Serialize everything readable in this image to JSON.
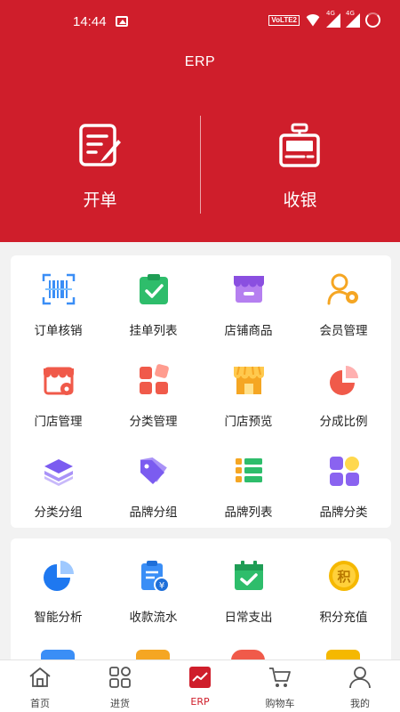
{
  "status": {
    "time": "14:44",
    "volte": "VoLTE2",
    "net1": "4G",
    "net2": "4G"
  },
  "header": {
    "title": "ERP"
  },
  "actions": [
    {
      "label": "开单",
      "icon": "edit-document-icon"
    },
    {
      "label": "收银",
      "icon": "cash-register-icon"
    }
  ],
  "grid1": [
    {
      "label": "订单核销",
      "icon": "barcode-scan-icon"
    },
    {
      "label": "挂单列表",
      "icon": "clipboard-check-icon"
    },
    {
      "label": "店铺商品",
      "icon": "shop-icon"
    },
    {
      "label": "会员管理",
      "icon": "user-settings-icon"
    },
    {
      "label": "门店管理",
      "icon": "store-settings-icon"
    },
    {
      "label": "分类管理",
      "icon": "category-icon"
    },
    {
      "label": "门店预览",
      "icon": "storefront-icon"
    },
    {
      "label": "分成比例",
      "icon": "pie-chart-icon"
    },
    {
      "label": "分类分组",
      "icon": "layers-icon"
    },
    {
      "label": "品牌分组",
      "icon": "tag-icon"
    },
    {
      "label": "品牌列表",
      "icon": "list-icon"
    },
    {
      "label": "品牌分类",
      "icon": "grid-icon"
    }
  ],
  "grid2": [
    {
      "label": "智能分析",
      "icon": "analysis-pie-icon"
    },
    {
      "label": "收款流水",
      "icon": "receipt-icon"
    },
    {
      "label": "日常支出",
      "icon": "calendar-check-icon"
    },
    {
      "label": "积分充值",
      "icon": "points-coin-icon"
    }
  ],
  "tabs": [
    {
      "label": "首页",
      "icon": "home-icon"
    },
    {
      "label": "进货",
      "icon": "apps-icon"
    },
    {
      "label": "ERP",
      "icon": "erp-chart-icon"
    },
    {
      "label": "购物车",
      "icon": "cart-icon"
    },
    {
      "label": "我的",
      "icon": "user-icon"
    }
  ],
  "colors": {
    "brand": "#cf1e2b",
    "blue": "#3a8ef6",
    "green": "#2ebd6b",
    "purple": "#8a63f0",
    "orange": "#f5a623",
    "red": "#f05a4a"
  }
}
